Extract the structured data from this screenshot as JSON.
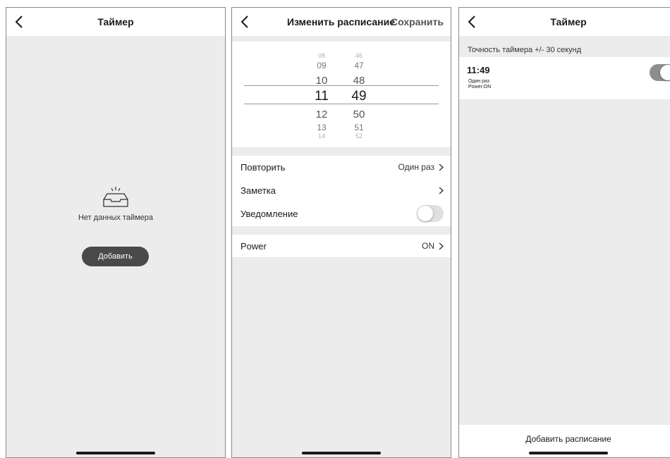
{
  "colors": {
    "screen_bg": "#ececec",
    "card_bg": "#ffffff",
    "add_button_bg": "#4a4a4a",
    "toggle_on": "#8e8e8e",
    "toggle_off": "#e0e0e0",
    "divider": "#9a9a9a"
  },
  "icons": {
    "back": "chevron-left-icon",
    "row_arrow": "chevron-right-icon",
    "empty": "empty-tray-icon"
  },
  "screen_timer_empty": {
    "title": "Таймер",
    "empty_text": "Нет данных таймера",
    "add_button": "Добавить"
  },
  "screen_edit_schedule": {
    "title": "Изменить расписание",
    "save": "Сохранить",
    "picker": {
      "hours": [
        "08",
        "09",
        "10",
        "11",
        "12",
        "13",
        "14"
      ],
      "minutes": [
        "46",
        "47",
        "48",
        "49",
        "50",
        "51",
        "52"
      ],
      "selected_hour": "11",
      "selected_minute": "49"
    },
    "rows": {
      "repeat_label": "Повторить",
      "repeat_value": "Один раз",
      "note_label": "Заметка",
      "notify_label": "Уведомление",
      "notify_on": false,
      "power_label": "Power",
      "power_value": "ON"
    }
  },
  "screen_timer_list": {
    "title": "Таймер",
    "accuracy_note": "Точность таймера +/- 30 секунд",
    "timer": {
      "time": "11:49",
      "repeat": "Один раз",
      "action": "Power:ON",
      "enabled": true
    },
    "add_schedule": "Добавить расписание"
  }
}
